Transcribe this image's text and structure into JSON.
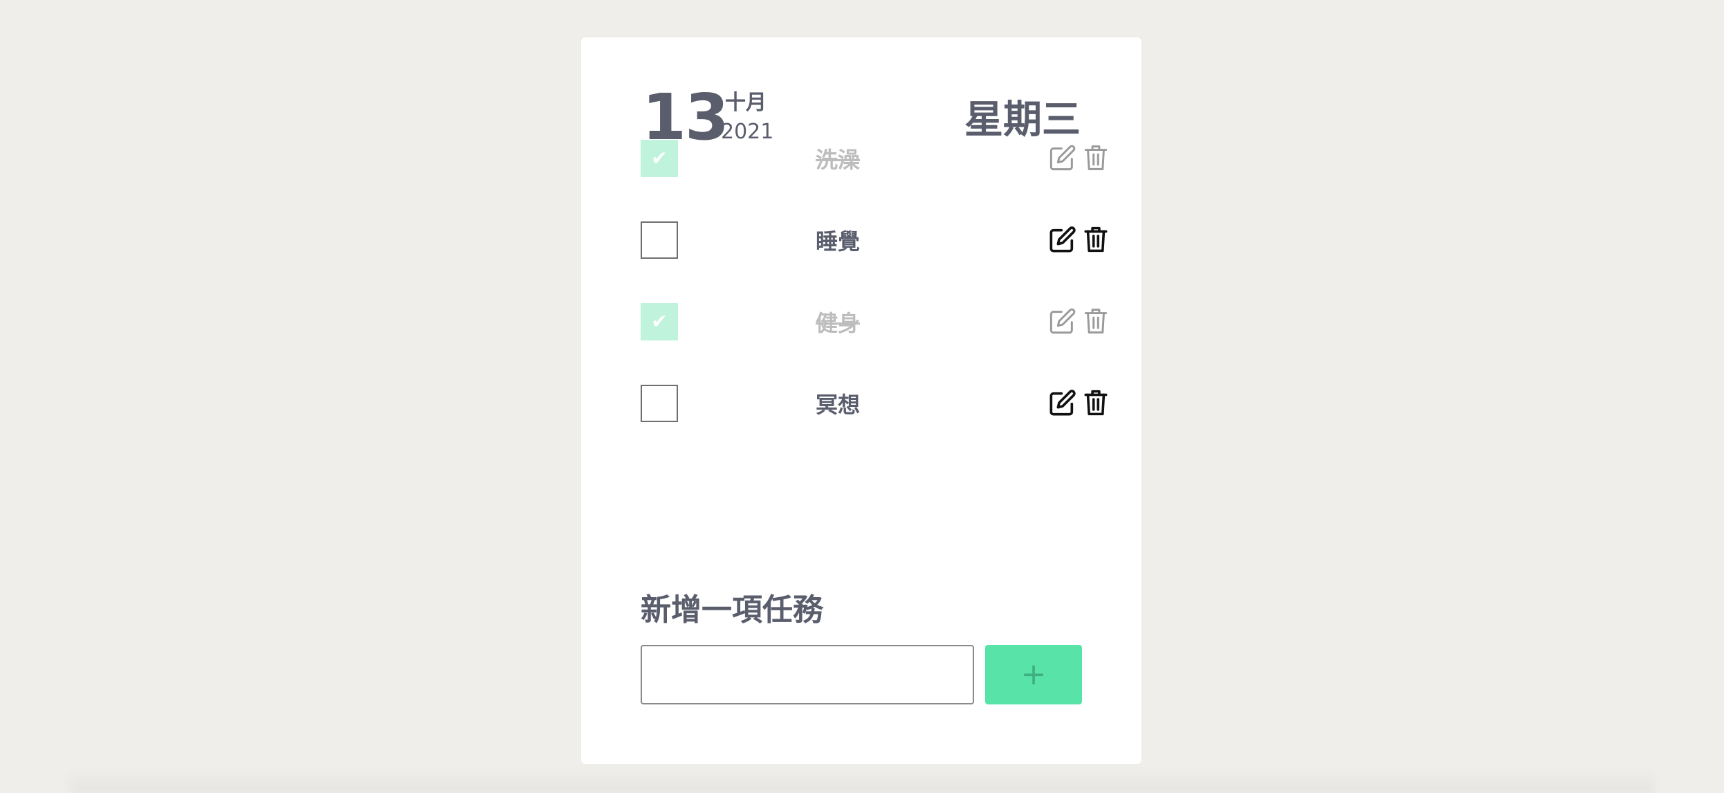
{
  "header": {
    "day": "13",
    "month": "十月",
    "year": "2021",
    "weekday": "星期三"
  },
  "tasks": [
    {
      "label": "洗澡",
      "done": true
    },
    {
      "label": "睡覺",
      "done": false
    },
    {
      "label": "健身",
      "done": true
    },
    {
      "label": "冥想",
      "done": false
    }
  ],
  "icons": {
    "check": "✔",
    "edit": "edit-icon",
    "delete": "trash-icon"
  },
  "add_task": {
    "title": "新增一項任務",
    "input_value": "",
    "input_placeholder": "",
    "button_label": "+"
  },
  "colors": {
    "background": "#efeeea",
    "card": "#ffffff",
    "text": "#5a5d6c",
    "done_text": "#bdbdbd",
    "checked_box": "#bff3dc",
    "accent": "#58e3a8"
  }
}
